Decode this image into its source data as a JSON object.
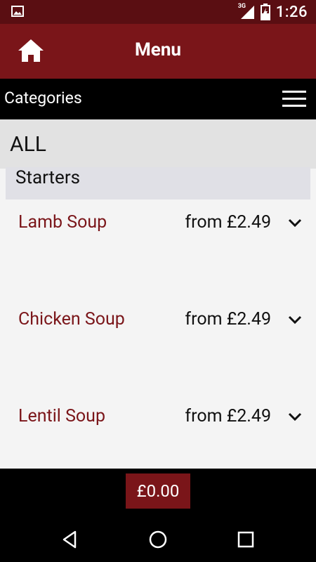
{
  "status_bar": {
    "network": "3G",
    "time": "1:26",
    "icons": [
      "image-notification-icon",
      "signal-icon",
      "battery-icon"
    ]
  },
  "app_bar": {
    "title": "Menu",
    "home_icon": "home-icon"
  },
  "categories_bar": {
    "label": "Categories",
    "menu_icon": "hamburger-icon"
  },
  "category": {
    "name": "ALL"
  },
  "section": {
    "name": "Starters",
    "items": [
      {
        "name": "Lamb Soup",
        "price": "from £2.49"
      },
      {
        "name": "Chicken Soup",
        "price": "from £2.49"
      },
      {
        "name": "Lentil Soup",
        "price": "from £2.49"
      }
    ]
  },
  "cart": {
    "total": "£0.00"
  },
  "nav_bar": {
    "icons": [
      "back-icon",
      "home-circle-icon",
      "recents-icon"
    ]
  },
  "colors": {
    "status_bar": "#5a0e12",
    "app_bar": "#7a1519",
    "accent_text": "#7a1519",
    "background": "#f4f4f4"
  }
}
